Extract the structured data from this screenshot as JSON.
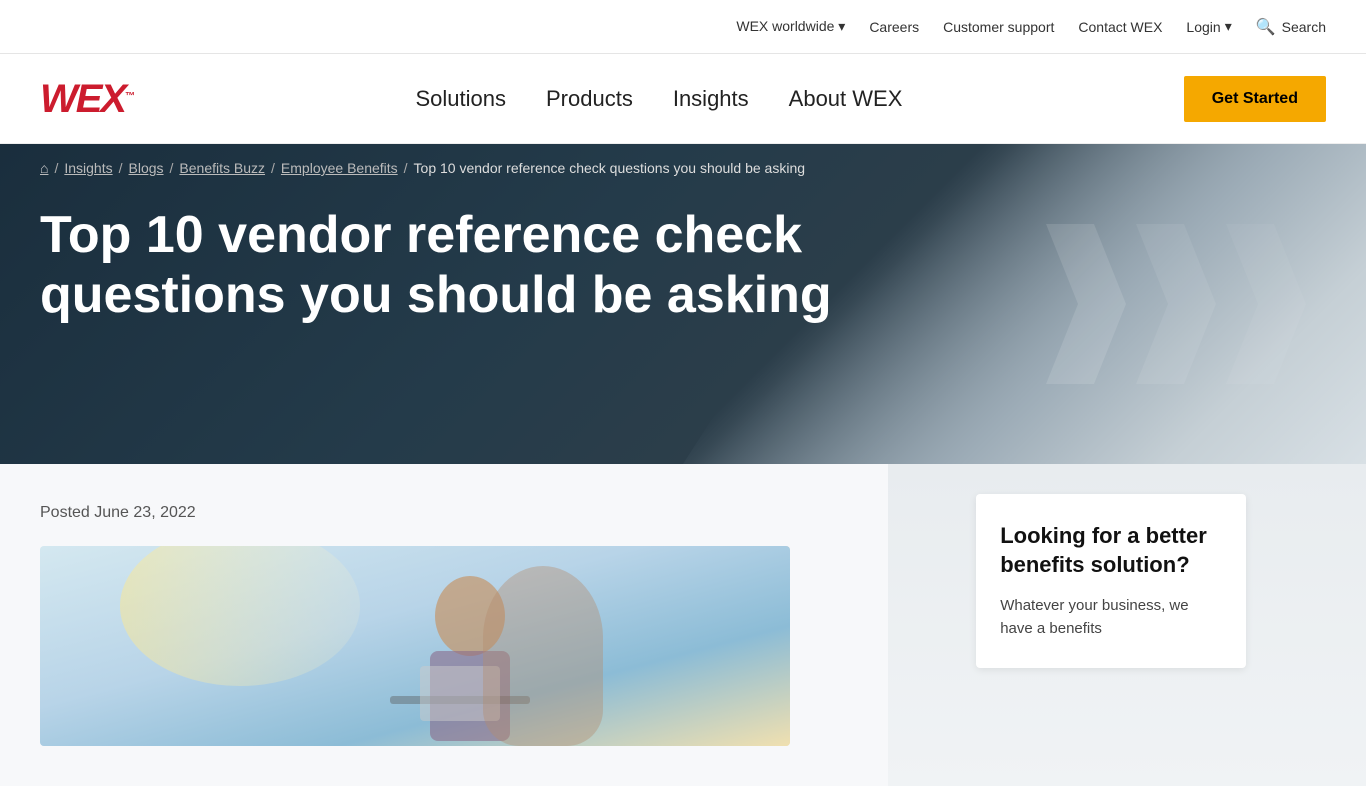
{
  "topbar": {
    "links": [
      {
        "label": "WEX worldwide",
        "has_arrow": true
      },
      {
        "label": "Careers"
      },
      {
        "label": "Customer support"
      },
      {
        "label": "Contact WEX"
      },
      {
        "label": "Login",
        "has_arrow": true
      }
    ],
    "search_label": "Search"
  },
  "header": {
    "logo_text": "wex",
    "logo_tm": "™",
    "nav": [
      {
        "label": "Solutions"
      },
      {
        "label": "Products"
      },
      {
        "label": "Insights"
      },
      {
        "label": "About WEX"
      }
    ],
    "cta_label": "Get Started"
  },
  "breadcrumb": {
    "home_icon": "⌂",
    "items": [
      {
        "label": "Insights",
        "link": true
      },
      {
        "label": "Blogs",
        "link": true
      },
      {
        "label": "Benefits Buzz",
        "link": true
      },
      {
        "label": "Employee Benefits",
        "link": true
      },
      {
        "label": "Top 10 vendor reference check questions you should be asking",
        "link": false
      }
    ]
  },
  "hero": {
    "title": "Top 10 vendor reference check questions you should be asking"
  },
  "article": {
    "posted_label": "Posted June 23, 2022"
  },
  "sidebar": {
    "card_title": "Looking for a better benefits solution?",
    "card_text": "Whatever your business, we have a benefits"
  }
}
